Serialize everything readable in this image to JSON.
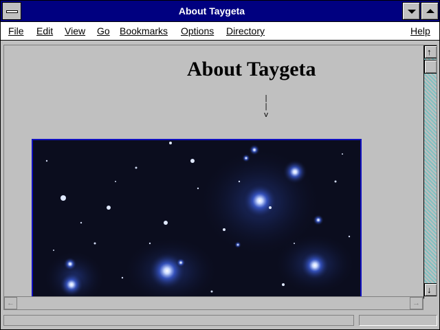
{
  "window": {
    "title": "About Taygeta"
  },
  "menubar": {
    "items": [
      {
        "label": "File"
      },
      {
        "label": "Edit"
      },
      {
        "label": "View"
      },
      {
        "label": "Go"
      },
      {
        "label": "Bookmarks"
      },
      {
        "label": "Options"
      },
      {
        "label": "Directory"
      }
    ],
    "help": "Help"
  },
  "page": {
    "heading": "About Taygeta",
    "arrow_art": "|\n|\nv",
    "image_alt": "Pleiades star cluster photograph"
  },
  "status": {
    "text": ""
  },
  "colors": {
    "titlebar": "#000080",
    "image_border": "#1010c0",
    "scroll_track": "#80c0c0"
  },
  "icons": {
    "system_menu": "system-menu-icon",
    "minimize": "triangle-down",
    "maximize": "triangle-up",
    "scroll_up": "arrow-up",
    "scroll_down": "arrow-down",
    "scroll_left": "arrow-left",
    "scroll_right": "arrow-right"
  }
}
